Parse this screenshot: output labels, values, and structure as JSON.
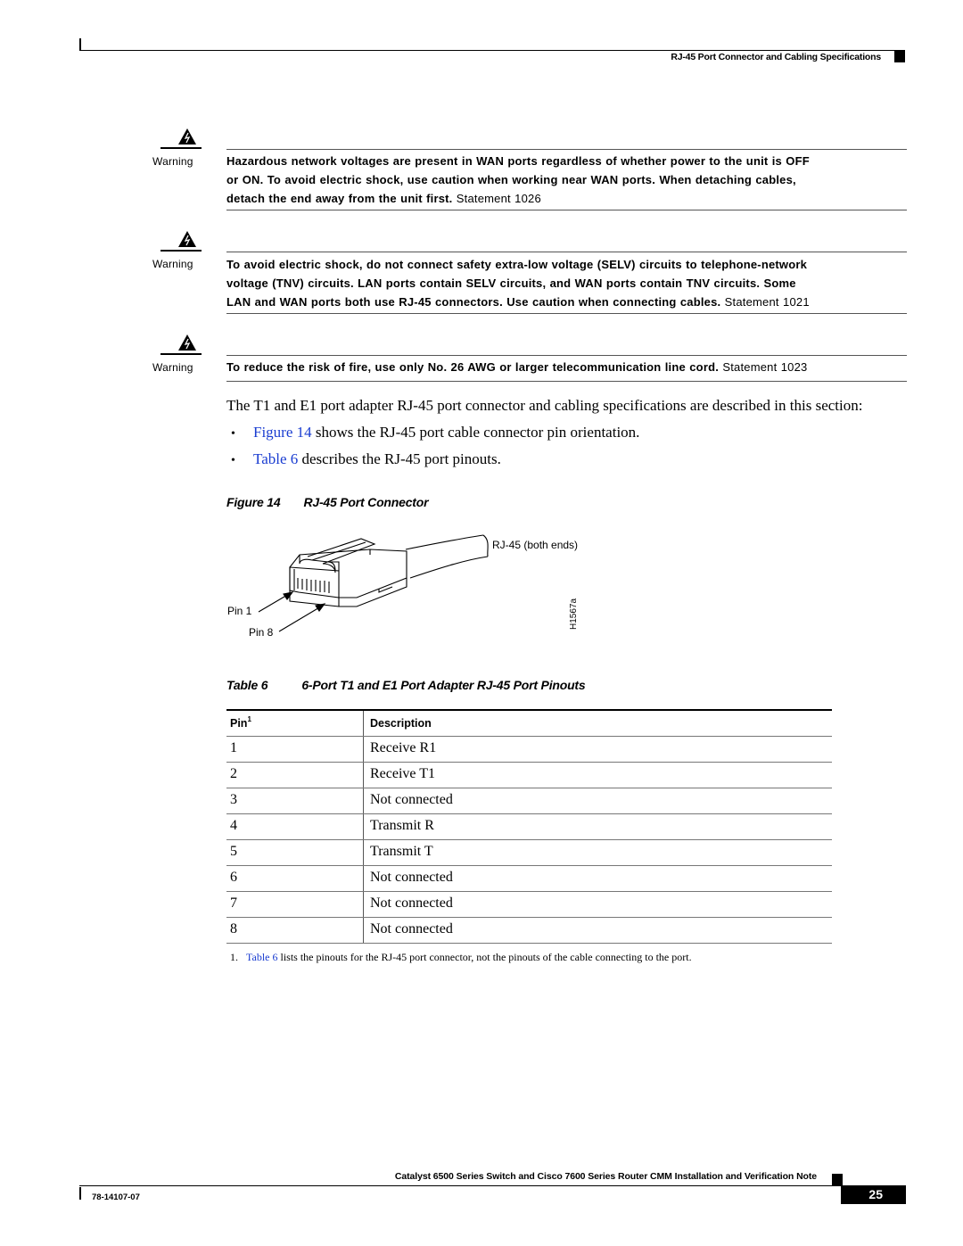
{
  "header": {
    "section_title": "RJ-45 Port Connector and Cabling Specifications"
  },
  "warnings": [
    {
      "icon": "warning-triangle-lightning-icon",
      "label": "Warning",
      "text": "Hazardous network voltages are present in WAN ports regardless of whether power to the unit is OFF or ON. To avoid electric shock, use caution when working near WAN ports. When detaching cables, detach the end away from the unit first.",
      "lines": [
        "Hazardous network voltages are present in WAN ports regardless of whether power to the unit is OFF",
        "or ON. To avoid electric shock, use caution when working near WAN ports. When detaching cables,",
        "detach the end away from the unit first."
      ],
      "statement": "Statement 1026"
    },
    {
      "icon": "warning-triangle-lightning-icon",
      "label": "Warning",
      "text": "To avoid electric shock, do not connect safety extra-low voltage (SELV) circuits to telephone-network voltage (TNV) circuits. LAN ports contain SELV circuits, and WAN ports contain TNV circuits. Some LAN and WAN ports both use RJ-45 connectors. Use caution when connecting cables.",
      "lines": [
        "To avoid electric shock, do not connect safety extra-low voltage (SELV) circuits to telephone-network",
        "voltage (TNV) circuits. LAN ports contain SELV circuits, and WAN ports contain TNV circuits. Some",
        "LAN and WAN ports both use RJ-45 connectors. Use caution when connecting cables."
      ],
      "statement": "Statement 1021"
    },
    {
      "icon": "warning-triangle-lightning-icon",
      "label": "Warning",
      "text": "To reduce the risk of fire, use only No. 26 AWG or larger telecommunication line cord.",
      "lines": [
        "To reduce the risk of fire, use only No. 26 AWG or larger telecommunication line cord."
      ],
      "statement": "Statement 1023"
    }
  ],
  "intro": "The T1 and E1 port adapter RJ-45 port connector and cabling specifications are described in this section:",
  "bullets": [
    {
      "link": "Figure 14",
      "text": " shows the RJ-45 port cable connector pin orientation."
    },
    {
      "link": "Table 6",
      "text": " describes the RJ-45 port pinouts."
    }
  ],
  "figure": {
    "number": "Figure 14",
    "title": "RJ-45 Port Connector",
    "labels": {
      "cable": "RJ-45 (both ends)",
      "pin1": "Pin 1",
      "pin8": "Pin 8",
      "art_id": "H1567a"
    }
  },
  "table": {
    "number": "Table 6",
    "title": "6-Port T1 and E1 Port Adapter RJ-45 Port Pinouts",
    "columns": [
      {
        "label": "Pin",
        "footnote_ref": "1"
      },
      {
        "label": "Description"
      }
    ],
    "rows": [
      {
        "pin": "1",
        "description": "Receive R1"
      },
      {
        "pin": "2",
        "description": "Receive T1"
      },
      {
        "pin": "3",
        "description": "Not connected"
      },
      {
        "pin": "4",
        "description": "Transmit R"
      },
      {
        "pin": "5",
        "description": "Transmit T"
      },
      {
        "pin": "6",
        "description": "Not connected"
      },
      {
        "pin": "7",
        "description": "Not connected"
      },
      {
        "pin": "8",
        "description": "Not connected"
      }
    ],
    "footnote": {
      "marker": "1.",
      "link": "Table 6",
      "text": " lists the pinouts for the RJ-45 port connector, not the pinouts of the cable connecting to the port."
    }
  },
  "footer": {
    "doc_title": "Catalyst 6500 Series Switch and Cisco 7600 Series Router CMM Installation and Verification Note",
    "doc_number": "78-14107-07",
    "page_number": "25"
  },
  "colors": {
    "link": "#1a3dd1",
    "text": "#000000"
  }
}
